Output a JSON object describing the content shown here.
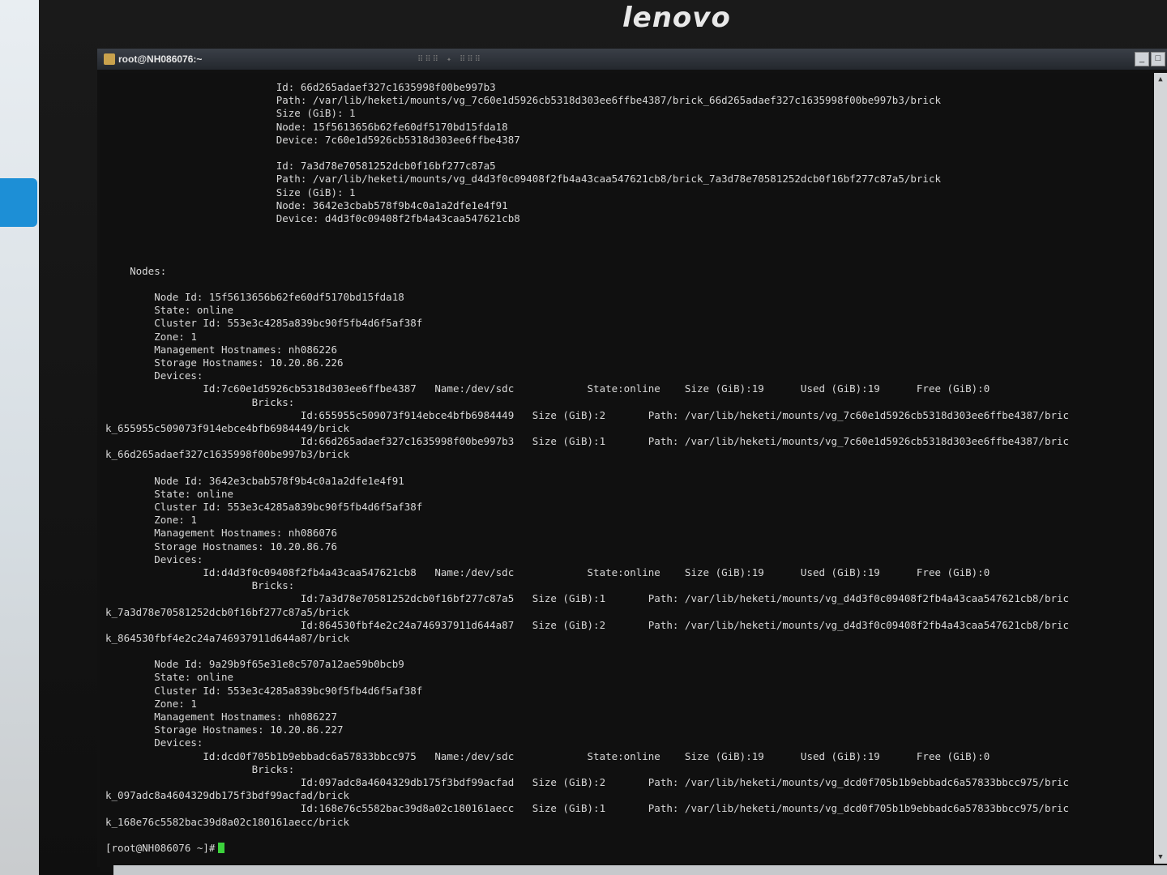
{
  "monitor": {
    "brand": "lenovo"
  },
  "window": {
    "title": "root@NH086076:~",
    "minimize": "_",
    "maximize": "□"
  },
  "terminal": {
    "lines": [
      "                            Id: 66d265adaef327c1635998f00be997b3",
      "                            Path: /var/lib/heketi/mounts/vg_7c60e1d5926cb5318d303ee6ffbe4387/brick_66d265adaef327c1635998f00be997b3/brick",
      "                            Size (GiB): 1",
      "                            Node: 15f5613656b62fe60df5170bd15fda18",
      "                            Device: 7c60e1d5926cb5318d303ee6ffbe4387",
      "",
      "                            Id: 7a3d78e70581252dcb0f16bf277c87a5",
      "                            Path: /var/lib/heketi/mounts/vg_d4d3f0c09408f2fb4a43caa547621cb8/brick_7a3d78e70581252dcb0f16bf277c87a5/brick",
      "                            Size (GiB): 1",
      "                            Node: 3642e3cbab578f9b4c0a1a2dfe1e4f91",
      "                            Device: d4d3f0c09408f2fb4a43caa547621cb8",
      "",
      "",
      "",
      "    Nodes:",
      "",
      "        Node Id: 15f5613656b62fe60df5170bd15fda18",
      "        State: online",
      "        Cluster Id: 553e3c4285a839bc90f5fb4d6f5af38f",
      "        Zone: 1",
      "        Management Hostnames: nh086226",
      "        Storage Hostnames: 10.20.86.226",
      "        Devices:",
      "                Id:7c60e1d5926cb5318d303ee6ffbe4387   Name:/dev/sdc            State:online    Size (GiB):19      Used (GiB):19      Free (GiB):0",
      "                        Bricks:",
      "                                Id:655955c509073f914ebce4bfb6984449   Size (GiB):2       Path: /var/lib/heketi/mounts/vg_7c60e1d5926cb5318d303ee6ffbe4387/bric",
      "k_655955c509073f914ebce4bfb6984449/brick",
      "                                Id:66d265adaef327c1635998f00be997b3   Size (GiB):1       Path: /var/lib/heketi/mounts/vg_7c60e1d5926cb5318d303ee6ffbe4387/bric",
      "k_66d265adaef327c1635998f00be997b3/brick",
      "",
      "        Node Id: 3642e3cbab578f9b4c0a1a2dfe1e4f91",
      "        State: online",
      "        Cluster Id: 553e3c4285a839bc90f5fb4d6f5af38f",
      "        Zone: 1",
      "        Management Hostnames: nh086076",
      "        Storage Hostnames: 10.20.86.76",
      "        Devices:",
      "                Id:d4d3f0c09408f2fb4a43caa547621cb8   Name:/dev/sdc            State:online    Size (GiB):19      Used (GiB):19      Free (GiB):0",
      "                        Bricks:",
      "                                Id:7a3d78e70581252dcb0f16bf277c87a5   Size (GiB):1       Path: /var/lib/heketi/mounts/vg_d4d3f0c09408f2fb4a43caa547621cb8/bric",
      "k_7a3d78e70581252dcb0f16bf277c87a5/brick",
      "                                Id:864530fbf4e2c24a746937911d644a87   Size (GiB):2       Path: /var/lib/heketi/mounts/vg_d4d3f0c09408f2fb4a43caa547621cb8/bric",
      "k_864530fbf4e2c24a746937911d644a87/brick",
      "",
      "        Node Id: 9a29b9f65e31e8c5707a12ae59b0bcb9",
      "        State: online",
      "        Cluster Id: 553e3c4285a839bc90f5fb4d6f5af38f",
      "        Zone: 1",
      "        Management Hostnames: nh086227",
      "        Storage Hostnames: 10.20.86.227",
      "        Devices:",
      "                Id:dcd0f705b1b9ebbadc6a57833bbcc975   Name:/dev/sdc            State:online    Size (GiB):19      Used (GiB):19      Free (GiB):0",
      "                        Bricks:",
      "                                Id:097adc8a4604329db175f3bdf99acfad   Size (GiB):2       Path: /var/lib/heketi/mounts/vg_dcd0f705b1b9ebbadc6a57833bbcc975/bric",
      "k_097adc8a4604329db175f3bdf99acfad/brick",
      "                                Id:168e76c5582bac39d8a02c180161aecc   Size (GiB):1       Path: /var/lib/heketi/mounts/vg_dcd0f705b1b9ebbadc6a57833bbcc975/bric",
      "k_168e76c5582bac39d8a02c180161aecc/brick",
      ""
    ],
    "prompt": "[root@NH086076 ~]#"
  },
  "colors": {
    "terminal_bg": "#101010",
    "terminal_fg": "#d8d8d8",
    "cursor": "#3cd23c"
  }
}
